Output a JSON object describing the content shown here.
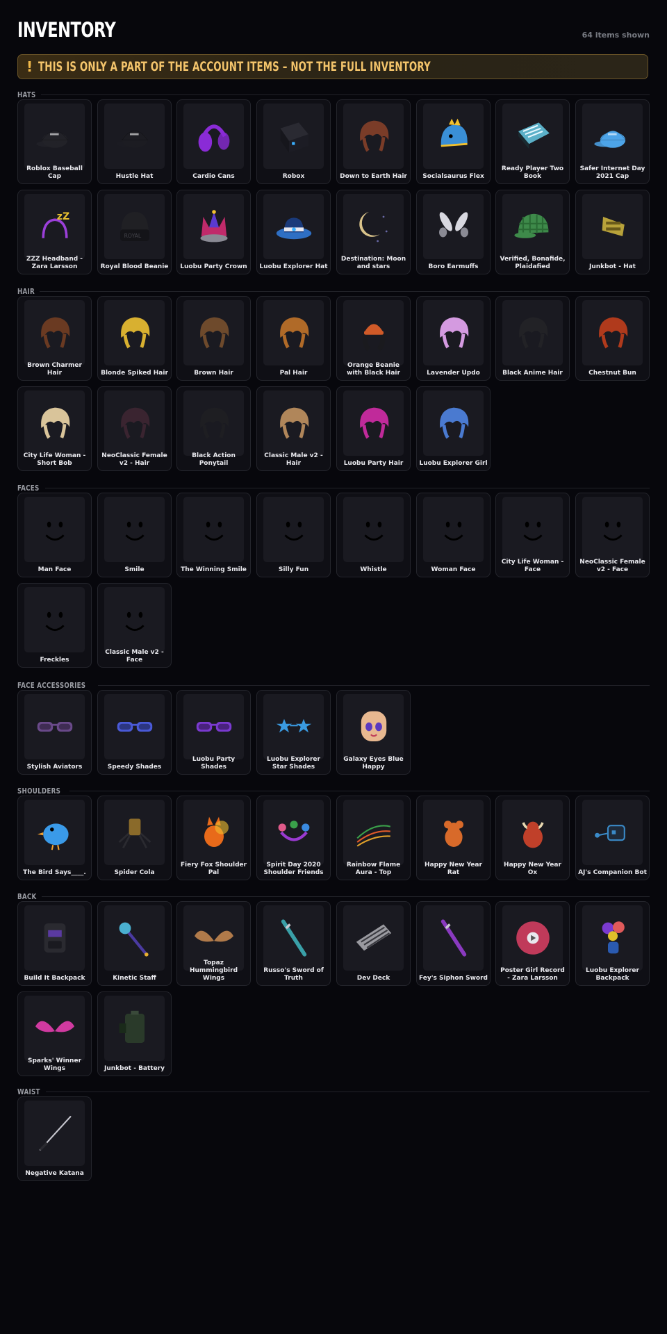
{
  "header": {
    "title": "INVENTORY",
    "count": "64 items shown"
  },
  "notice": {
    "icon": "!",
    "text": "THIS IS ONLY A PART OF THE ACCOUNT ITEMS – NOT THE FULL INVENTORY"
  },
  "sections": [
    {
      "title": "HATS",
      "items": [
        {
          "name": "Roblox Baseball Cap",
          "icon": "cap-icon",
          "color": "#222228"
        },
        {
          "name": "Hustle Hat",
          "icon": "cap-icon",
          "color": "#1c1c22"
        },
        {
          "name": "Cardio Cans",
          "icon": "earmuffs-icon",
          "color": "#8a2bd6"
        },
        {
          "name": "Robox",
          "icon": "box-icon",
          "color": "#1c1c24"
        },
        {
          "name": "Down to Earth Hair",
          "icon": "hair-icon",
          "color": "#7a3c28"
        },
        {
          "name": "Socialsaurus Flex",
          "icon": "dino-hat-icon",
          "color": "#3a8fd6"
        },
        {
          "name": "Ready Player Two Book",
          "icon": "book-icon",
          "color": "#5bb0c8"
        },
        {
          "name": "Safer Internet Day 2021 Cap",
          "icon": "cap-icon",
          "color": "#4da4e8"
        },
        {
          "name": "ZZZ Headband - Zara Larsson",
          "icon": "headband-icon",
          "color": "#9b3fd9"
        },
        {
          "name": "Royal Blood Beanie",
          "icon": "beanie-icon",
          "color": "#202024"
        },
        {
          "name": "Luobu Party Crown",
          "icon": "crown-icon",
          "color": "#c02a6a"
        },
        {
          "name": "Luobu Explorer Hat",
          "icon": "fedora-icon",
          "color": "#2e6fc4"
        },
        {
          "name": "Destination: Moon and stars",
          "icon": "moon-icon",
          "color": "#d9c38a"
        },
        {
          "name": "Boro Earmuffs",
          "icon": "bunny-ears-icon",
          "color": "#d8d8e0"
        },
        {
          "name": "Verified, Bonafide, Plaidafied",
          "icon": "plaid-cap-icon",
          "color": "#3e8a4a"
        },
        {
          "name": "Junkbot - Hat",
          "icon": "junk-hat-icon",
          "color": "#b8a23a"
        }
      ]
    },
    {
      "title": "HAIR",
      "items": [
        {
          "name": "Brown Charmer Hair",
          "icon": "hair-icon",
          "color": "#6a3a22"
        },
        {
          "name": "Blonde Spiked Hair",
          "icon": "hair-icon",
          "color": "#d8b030"
        },
        {
          "name": "Brown Hair",
          "icon": "hair-icon",
          "color": "#6e4a2c"
        },
        {
          "name": "Pal Hair",
          "icon": "hair-icon",
          "color": "#b06a28"
        },
        {
          "name": "Orange Beanie with Black Hair",
          "icon": "beanie-hair-icon",
          "color": "#d05a28"
        },
        {
          "name": "Lavender Updo",
          "icon": "hair-icon",
          "color": "#d49ae0"
        },
        {
          "name": "Black Anime Hair",
          "icon": "hair-icon",
          "color": "#222226"
        },
        {
          "name": "Chestnut Bun",
          "icon": "hair-icon",
          "color": "#b03a1c"
        },
        {
          "name": "City Life Woman - Short Bob",
          "icon": "hair-icon",
          "color": "#d9c49a"
        },
        {
          "name": "NeoClassic Female v2 - Hair",
          "icon": "hair-icon",
          "color": "#3a2430"
        },
        {
          "name": "Black Action Ponytail",
          "icon": "hair-icon",
          "color": "#1e1e22"
        },
        {
          "name": "Classic Male v2 - Hair",
          "icon": "hair-icon",
          "color": "#b0865a"
        },
        {
          "name": "Luobu Party Hair",
          "icon": "hair-icon",
          "color": "#c02a9a"
        },
        {
          "name": "Luobu Explorer Girl",
          "icon": "hair-icon",
          "color": "#4a7ad0"
        }
      ]
    },
    {
      "title": "FACES",
      "items": [
        {
          "name": "Man Face",
          "icon": "face-icon",
          "color": "#000000"
        },
        {
          "name": "Smile",
          "icon": "face-icon",
          "color": "#000000"
        },
        {
          "name": "The Winning Smile",
          "icon": "face-icon",
          "color": "#000000"
        },
        {
          "name": "Silly Fun",
          "icon": "face-icon",
          "color": "#000000"
        },
        {
          "name": "Whistle",
          "icon": "face-icon",
          "color": "#000000"
        },
        {
          "name": "Woman Face",
          "icon": "face-icon",
          "color": "#000000"
        },
        {
          "name": "City Life Woman - Face",
          "icon": "face-icon",
          "color": "#000000"
        },
        {
          "name": "NeoClassic Female v2 - Face",
          "icon": "face-icon",
          "color": "#000000"
        },
        {
          "name": "Freckles",
          "icon": "face-icon",
          "color": "#000000"
        },
        {
          "name": "Classic Male v2 - Face",
          "icon": "face-icon",
          "color": "#000000"
        }
      ]
    },
    {
      "title": "FACE ACCESSORIES",
      "items": [
        {
          "name": "Stylish Aviators",
          "icon": "glasses-icon",
          "color": "#6a4a8a"
        },
        {
          "name": "Speedy Shades",
          "icon": "glasses-icon",
          "color": "#4a5ad8"
        },
        {
          "name": "Luobu Party Shades",
          "icon": "glasses-icon",
          "color": "#7a3ad0"
        },
        {
          "name": "Luobu Explorer Star Shades",
          "icon": "star-glasses-icon",
          "color": "#3a9ae0"
        },
        {
          "name": "Galaxy Eyes Blue Happy",
          "icon": "head-icon",
          "color": "#e8b890"
        }
      ]
    },
    {
      "title": "SHOULDERS",
      "items": [
        {
          "name": "The Bird Says____.",
          "icon": "bird-icon",
          "color": "#3a9ae8"
        },
        {
          "name": "Spider Cola",
          "icon": "spider-icon",
          "color": "#8a6a2a"
        },
        {
          "name": "Fiery Fox Shoulder Pal",
          "icon": "fox-icon",
          "color": "#e86a1a"
        },
        {
          "name": "Spirit Day 2020 Shoulder Friends",
          "icon": "friends-icon",
          "color": "#9a3ad0"
        },
        {
          "name": "Rainbow Flame Aura - Top",
          "icon": "aura-icon",
          "color": "#4aa04a"
        },
        {
          "name": "Happy New Year Rat",
          "icon": "rat-icon",
          "color": "#d86a2a"
        },
        {
          "name": "Happy New Year Ox",
          "icon": "ox-icon",
          "color": "#c0402a"
        },
        {
          "name": "AJ's Companion Bot",
          "icon": "bot-icon",
          "color": "#3a8ac8"
        }
      ]
    },
    {
      "title": "BACK",
      "items": [
        {
          "name": "Build It Backpack",
          "icon": "backpack-icon",
          "color": "#2a2a30"
        },
        {
          "name": "Kinetic Staff",
          "icon": "staff-icon",
          "color": "#4ab0d0"
        },
        {
          "name": "Topaz Hummingbird Wings",
          "icon": "wings-icon",
          "color": "#b07a4a"
        },
        {
          "name": "Russo's Sword of Truth",
          "icon": "sword-icon",
          "color": "#3aa0a8"
        },
        {
          "name": "Dev Deck",
          "icon": "keyboard-icon",
          "color": "#9a9aa0"
        },
        {
          "name": "Fey's Siphon Sword",
          "icon": "sword-icon",
          "color": "#8a3ac0"
        },
        {
          "name": "Poster Girl Record - Zara Larsson",
          "icon": "record-icon",
          "color": "#c03a5a"
        },
        {
          "name": "Luobu Explorer Backpack",
          "icon": "balloons-icon",
          "color": "#7a3ad0"
        },
        {
          "name": "Sparks' Winner Wings",
          "icon": "wings-icon",
          "color": "#d03aa0"
        },
        {
          "name": "Junkbot - Battery",
          "icon": "battery-icon",
          "color": "#2a3a2a"
        }
      ]
    },
    {
      "title": "WAIST",
      "items": [
        {
          "name": "Negative Katana",
          "icon": "katana-icon",
          "color": "#c8c8d0"
        }
      ]
    }
  ]
}
